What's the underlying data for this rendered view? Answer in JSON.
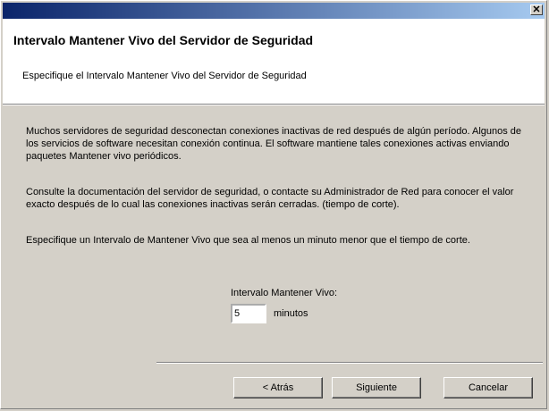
{
  "window": {
    "close_glyph": "✕"
  },
  "header": {
    "title": "Intervalo Mantener Vivo del Servidor de Seguridad",
    "subtitle": "Especifique el Intervalo Mantener Vivo del Servidor de Seguridad"
  },
  "body": {
    "paragraph1": "Muchos servidores de seguridad desconectan conexiones inactivas de red después de algún período.  Algunos de los servicios de software necesitan conexión continua.  El software mantiene tales conexiones activas enviando paquetes Mantener vivo periódicos.",
    "paragraph2": "Consulte la documentación del servidor de seguridad, o contacte su Administrador de Red para conocer el valor exacto después de lo cual las conexiones inactivas serán cerradas. (tiempo de corte).",
    "paragraph3": "Especifique un Intervalo de Mantener Vivo que sea al menos un minuto menor que el tiempo de corte."
  },
  "field": {
    "label": "Intervalo Mantener Vivo:",
    "value": "5",
    "unit": "minutos"
  },
  "buttons": {
    "back_label": "< Atrás",
    "next_label": "Siguiente",
    "cancel_label": "Cancelar"
  }
}
